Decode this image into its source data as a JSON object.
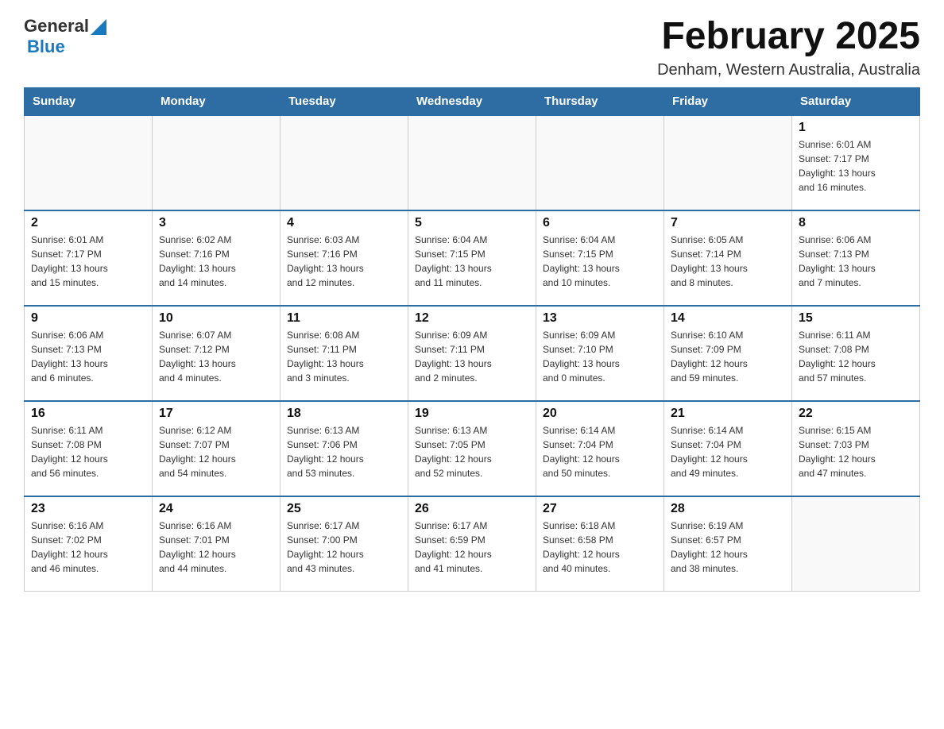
{
  "header": {
    "logo": {
      "general": "General",
      "blue": "Blue"
    },
    "title": "February 2025",
    "location": "Denham, Western Australia, Australia"
  },
  "weekdays": [
    "Sunday",
    "Monday",
    "Tuesday",
    "Wednesday",
    "Thursday",
    "Friday",
    "Saturday"
  ],
  "weeks": [
    {
      "days": [
        {
          "num": "",
          "info": ""
        },
        {
          "num": "",
          "info": ""
        },
        {
          "num": "",
          "info": ""
        },
        {
          "num": "",
          "info": ""
        },
        {
          "num": "",
          "info": ""
        },
        {
          "num": "",
          "info": ""
        },
        {
          "num": "1",
          "info": "Sunrise: 6:01 AM\nSunset: 7:17 PM\nDaylight: 13 hours\nand 16 minutes."
        }
      ]
    },
    {
      "days": [
        {
          "num": "2",
          "info": "Sunrise: 6:01 AM\nSunset: 7:17 PM\nDaylight: 13 hours\nand 15 minutes."
        },
        {
          "num": "3",
          "info": "Sunrise: 6:02 AM\nSunset: 7:16 PM\nDaylight: 13 hours\nand 14 minutes."
        },
        {
          "num": "4",
          "info": "Sunrise: 6:03 AM\nSunset: 7:16 PM\nDaylight: 13 hours\nand 12 minutes."
        },
        {
          "num": "5",
          "info": "Sunrise: 6:04 AM\nSunset: 7:15 PM\nDaylight: 13 hours\nand 11 minutes."
        },
        {
          "num": "6",
          "info": "Sunrise: 6:04 AM\nSunset: 7:15 PM\nDaylight: 13 hours\nand 10 minutes."
        },
        {
          "num": "7",
          "info": "Sunrise: 6:05 AM\nSunset: 7:14 PM\nDaylight: 13 hours\nand 8 minutes."
        },
        {
          "num": "8",
          "info": "Sunrise: 6:06 AM\nSunset: 7:13 PM\nDaylight: 13 hours\nand 7 minutes."
        }
      ]
    },
    {
      "days": [
        {
          "num": "9",
          "info": "Sunrise: 6:06 AM\nSunset: 7:13 PM\nDaylight: 13 hours\nand 6 minutes."
        },
        {
          "num": "10",
          "info": "Sunrise: 6:07 AM\nSunset: 7:12 PM\nDaylight: 13 hours\nand 4 minutes."
        },
        {
          "num": "11",
          "info": "Sunrise: 6:08 AM\nSunset: 7:11 PM\nDaylight: 13 hours\nand 3 minutes."
        },
        {
          "num": "12",
          "info": "Sunrise: 6:09 AM\nSunset: 7:11 PM\nDaylight: 13 hours\nand 2 minutes."
        },
        {
          "num": "13",
          "info": "Sunrise: 6:09 AM\nSunset: 7:10 PM\nDaylight: 13 hours\nand 0 minutes."
        },
        {
          "num": "14",
          "info": "Sunrise: 6:10 AM\nSunset: 7:09 PM\nDaylight: 12 hours\nand 59 minutes."
        },
        {
          "num": "15",
          "info": "Sunrise: 6:11 AM\nSunset: 7:08 PM\nDaylight: 12 hours\nand 57 minutes."
        }
      ]
    },
    {
      "days": [
        {
          "num": "16",
          "info": "Sunrise: 6:11 AM\nSunset: 7:08 PM\nDaylight: 12 hours\nand 56 minutes."
        },
        {
          "num": "17",
          "info": "Sunrise: 6:12 AM\nSunset: 7:07 PM\nDaylight: 12 hours\nand 54 minutes."
        },
        {
          "num": "18",
          "info": "Sunrise: 6:13 AM\nSunset: 7:06 PM\nDaylight: 12 hours\nand 53 minutes."
        },
        {
          "num": "19",
          "info": "Sunrise: 6:13 AM\nSunset: 7:05 PM\nDaylight: 12 hours\nand 52 minutes."
        },
        {
          "num": "20",
          "info": "Sunrise: 6:14 AM\nSunset: 7:04 PM\nDaylight: 12 hours\nand 50 minutes."
        },
        {
          "num": "21",
          "info": "Sunrise: 6:14 AM\nSunset: 7:04 PM\nDaylight: 12 hours\nand 49 minutes."
        },
        {
          "num": "22",
          "info": "Sunrise: 6:15 AM\nSunset: 7:03 PM\nDaylight: 12 hours\nand 47 minutes."
        }
      ]
    },
    {
      "days": [
        {
          "num": "23",
          "info": "Sunrise: 6:16 AM\nSunset: 7:02 PM\nDaylight: 12 hours\nand 46 minutes."
        },
        {
          "num": "24",
          "info": "Sunrise: 6:16 AM\nSunset: 7:01 PM\nDaylight: 12 hours\nand 44 minutes."
        },
        {
          "num": "25",
          "info": "Sunrise: 6:17 AM\nSunset: 7:00 PM\nDaylight: 12 hours\nand 43 minutes."
        },
        {
          "num": "26",
          "info": "Sunrise: 6:17 AM\nSunset: 6:59 PM\nDaylight: 12 hours\nand 41 minutes."
        },
        {
          "num": "27",
          "info": "Sunrise: 6:18 AM\nSunset: 6:58 PM\nDaylight: 12 hours\nand 40 minutes."
        },
        {
          "num": "28",
          "info": "Sunrise: 6:19 AM\nSunset: 6:57 PM\nDaylight: 12 hours\nand 38 minutes."
        },
        {
          "num": "",
          "info": ""
        }
      ]
    }
  ]
}
